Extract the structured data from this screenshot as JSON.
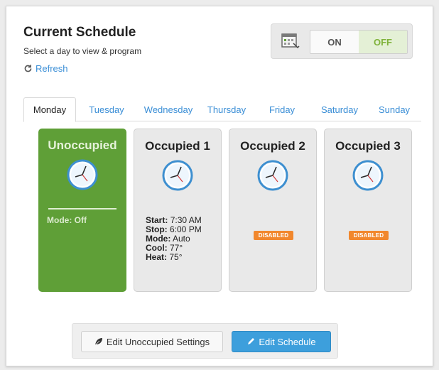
{
  "header": {
    "title": "Current Schedule",
    "subtitle": "Select a day to view & program",
    "refresh_label": "Refresh"
  },
  "toggle": {
    "on_label": "ON",
    "off_label": "OFF",
    "selected": "OFF"
  },
  "tabs": [
    {
      "label": "Monday",
      "active": true
    },
    {
      "label": "Tuesday",
      "active": false
    },
    {
      "label": "Wednesday",
      "active": false
    },
    {
      "label": "Thursday",
      "active": false
    },
    {
      "label": "Friday",
      "active": false
    },
    {
      "label": "Saturday",
      "active": false
    },
    {
      "label": "Sunday",
      "active": false
    }
  ],
  "cards": [
    {
      "title": "Unoccupied",
      "mode_label": "Mode:",
      "mode_value": "Off"
    },
    {
      "title": "Occupied 1",
      "start_label": "Start:",
      "start_value": "7:30 AM",
      "stop_label": "Stop:",
      "stop_value": "6:00 PM",
      "mode_label": "Mode:",
      "mode_value": "Auto",
      "cool_label": "Cool:",
      "cool_value": "77°",
      "heat_label": "Heat:",
      "heat_value": "75°"
    },
    {
      "title": "Occupied 2",
      "badge": "DISABLED"
    },
    {
      "title": "Occupied 3",
      "badge": "DISABLED"
    }
  ],
  "actions": {
    "edit_unoccupied_label": "Edit Unoccupied Settings",
    "edit_schedule_label": "Edit Schedule"
  },
  "colors": {
    "accent_blue": "#3a8ed6",
    "green_card": "#5f9f37",
    "badge_orange": "#f1872d",
    "button_blue": "#3d9fdc"
  },
  "icons": {
    "refresh": "refresh-icon",
    "calendar": "calendar-icon",
    "clock": "clock-icon",
    "leaf": "leaf-icon",
    "pencil": "pencil-icon"
  }
}
